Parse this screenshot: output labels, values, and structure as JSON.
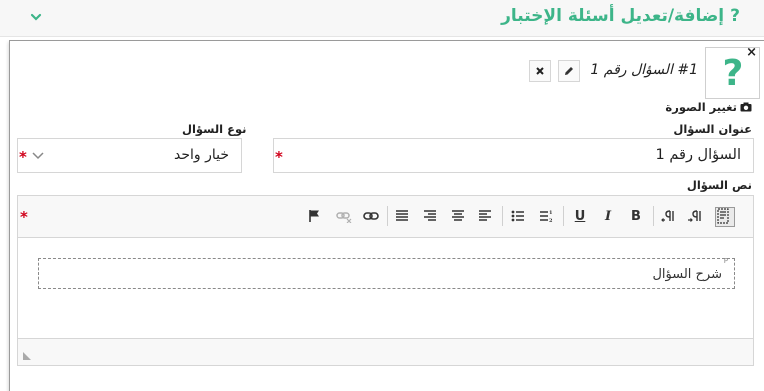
{
  "section": {
    "title": "إضافة/تعديل أسئلة الإختبار",
    "help_icon": "question-mark-icon",
    "collapse_icon": "chevron-down-icon",
    "accent_color": "#3db589"
  },
  "question": {
    "heading": "#1 السؤال رقم 1",
    "image_placeholder": "?",
    "remove_image": "×",
    "change_image_label": "تغيير الصورة",
    "edit_icon": "pencil-icon",
    "delete_icon": "close-icon"
  },
  "form": {
    "title_label": "عنوان السؤال",
    "title_value": "السؤال رقم 1",
    "type_label": "نوع السؤال",
    "type_value": "خيار واحد",
    "text_label": "نص السؤال",
    "required_mark": "*",
    "required_color": "#d0021b"
  },
  "editor": {
    "toolbar": {
      "bold": "B",
      "italic": "I",
      "underline": "U"
    },
    "block_tag": "P",
    "content": "شرح السؤال"
  }
}
